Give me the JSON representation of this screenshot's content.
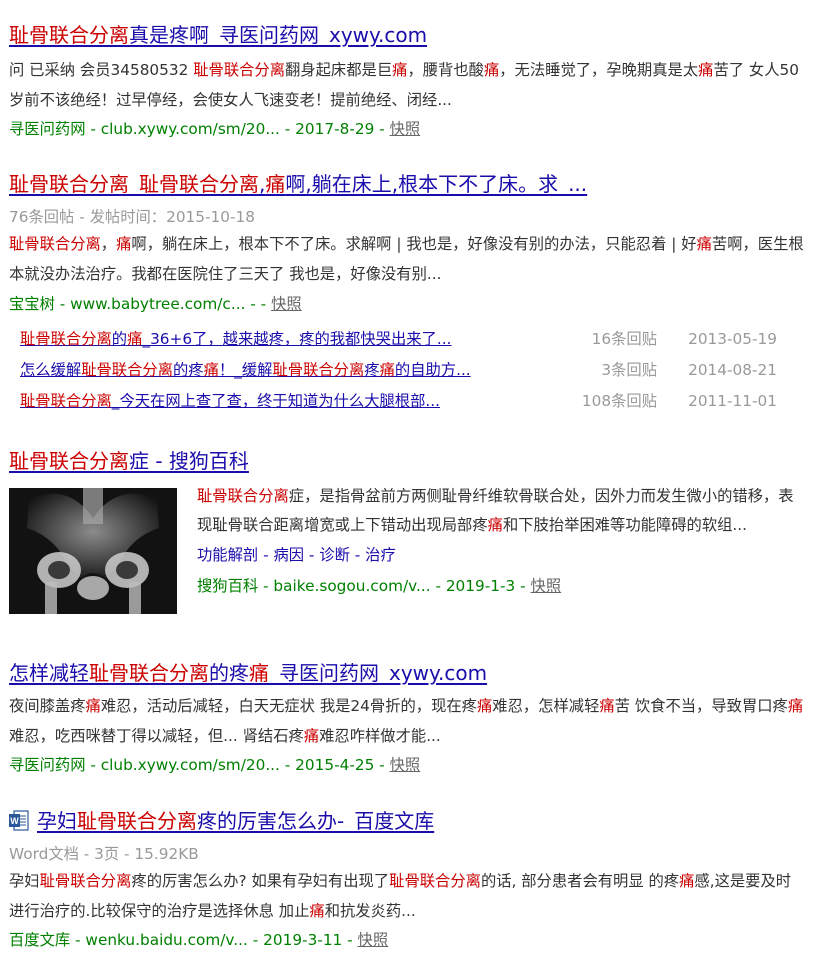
{
  "results": [
    {
      "title_parts": [
        "耻骨联合分离",
        "真是疼啊_寻医问药网_xywy.com"
      ],
      "snippet_parts": [
        [
          "问 已采纳 会员34580532 ",
          false
        ],
        [
          "耻骨联合分离",
          true
        ],
        [
          "翻身起床都是巨",
          false
        ],
        [
          "痛",
          true
        ],
        [
          "，腰背也酸",
          false
        ],
        [
          "痛",
          true
        ],
        [
          "，无法睡觉了，孕晚期真是太",
          false
        ],
        [
          "痛",
          true
        ],
        [
          "苦了 女人50岁前不该绝经！过早停经，会使女人飞速变老！提前绝经、闭经...",
          false
        ]
      ],
      "cite": "寻医问药网 - club.xywy.com/sm/20... - 2017-8-29 - ",
      "snapshot": "快照"
    },
    {
      "title_parts": [
        "耻骨联合分离",
        "_",
        "耻骨联合分离",
        ",",
        "痛",
        "啊,躺在床上,根本下不了床。求_..."
      ],
      "meta": "76条回帖 - 发帖时间：2015-10-18",
      "snippet_parts": [
        [
          "耻骨联合分离",
          true
        ],
        [
          "，",
          false
        ],
        [
          "痛",
          true
        ],
        [
          "啊，躺在床上，根本下不了床。求解啊 | 我也是，好像没有别的办法，只能忍着 | 好",
          false
        ],
        [
          "痛",
          true
        ],
        [
          "苦啊，医生根本就没办法治疗。我都在医院住了三天了 我也是，好像没有别...",
          false
        ]
      ],
      "cite": "宝宝树 - www.babytree.com/c... - - ",
      "snapshot": "快照",
      "threads": [
        {
          "parts": [
            [
              "耻骨联合分离",
              true
            ],
            [
              "的",
              false
            ],
            [
              "痛",
              true
            ],
            [
              "_36+6了，越来越疼，疼的我都快哭出来了...",
              false
            ]
          ],
          "count": "16条回贴",
          "date": "2013-05-19"
        },
        {
          "parts": [
            [
              "怎么缓解",
              false
            ],
            [
              "耻骨联合分离",
              true
            ],
            [
              "的疼",
              false
            ],
            [
              "痛",
              true
            ],
            [
              "！_缓解",
              false
            ],
            [
              "耻骨联合分离",
              true
            ],
            [
              "疼",
              false
            ],
            [
              "痛",
              true
            ],
            [
              "的自助方...",
              false
            ]
          ],
          "count": "3条回贴",
          "date": "2014-08-21"
        },
        {
          "parts": [
            [
              "耻骨联合分离",
              true
            ],
            [
              "_今天在网上查了查，终于知道为什么大腿根部...",
              false
            ]
          ],
          "count": "108条回贴",
          "date": "2011-11-01"
        }
      ]
    },
    {
      "title_parts": [
        "耻骨联合分离",
        "症 - 搜狗百科"
      ],
      "snippet_parts": [
        [
          "耻骨联合分离",
          true
        ],
        [
          "症，是指骨盆前方两侧耻骨纤维软骨联合处，因外力而发生微小的错移，表现耻骨联合距离增宽或上下错动出现局部疼",
          false
        ],
        [
          "痛",
          true
        ],
        [
          "和下肢抬举困难等功能障碍的软组...",
          false
        ]
      ],
      "links": [
        "功能解剖",
        "病因",
        "诊断",
        "治疗"
      ],
      "cite": "搜狗百科 - baike.sogou.com/v... - 2019-1-3 - ",
      "snapshot": "快照"
    },
    {
      "title_parts": [
        "怎样减轻",
        "耻骨联合分离",
        "的疼",
        "痛",
        "_寻医问药网_xywy.com"
      ],
      "snippet_parts": [
        [
          "夜间膝盖疼",
          false
        ],
        [
          "痛",
          true
        ],
        [
          "难忍，活动后减轻，白天无症状 我是24骨折的，现在疼",
          false
        ],
        [
          "痛",
          true
        ],
        [
          "难忍，怎样减轻",
          false
        ],
        [
          "痛",
          true
        ],
        [
          "苦 饮食不当，导致胃口疼",
          false
        ],
        [
          "痛",
          true
        ],
        [
          "难忍，吃西咪替丁得以减轻，但... 肾结石疼",
          false
        ],
        [
          "痛",
          true
        ],
        [
          "难忍咋样做才能...",
          false
        ]
      ],
      "cite": "寻医问药网 - club.xywy.com/sm/20... - 2015-4-25 - ",
      "snapshot": "快照"
    },
    {
      "title_parts": [
        "孕妇",
        "耻骨联合分离",
        "疼的厉害怎么办-_百度文库"
      ],
      "meta": "Word文档 - 3页 - 15.92KB",
      "snippet_parts": [
        [
          "孕妇",
          false
        ],
        [
          "耻骨联合分离",
          true
        ],
        [
          "疼的厉害怎么办? 如果有孕妇有出现了",
          false
        ],
        [
          "耻骨联合分离",
          true
        ],
        [
          "的话, 部分患者会有明显 的疼",
          false
        ],
        [
          "痛",
          true
        ],
        [
          "感,这是要及时进行治疗的.比较保守的治疗是选择休息 加止",
          false
        ],
        [
          "痛",
          true
        ],
        [
          "和抗发炎药...",
          false
        ]
      ],
      "cite": "百度文库 - wenku.baidu.com/v... - 2019-3-11 - ",
      "snapshot": "快照"
    }
  ],
  "colors": {
    "link": "#1a0dab",
    "highlight": "#cc0000",
    "cite": "#008000",
    "meta": "#999999",
    "text": "#333333"
  },
  "icons": {
    "word_doc": "word-doc-icon",
    "xray": "xray-thumbnail"
  }
}
